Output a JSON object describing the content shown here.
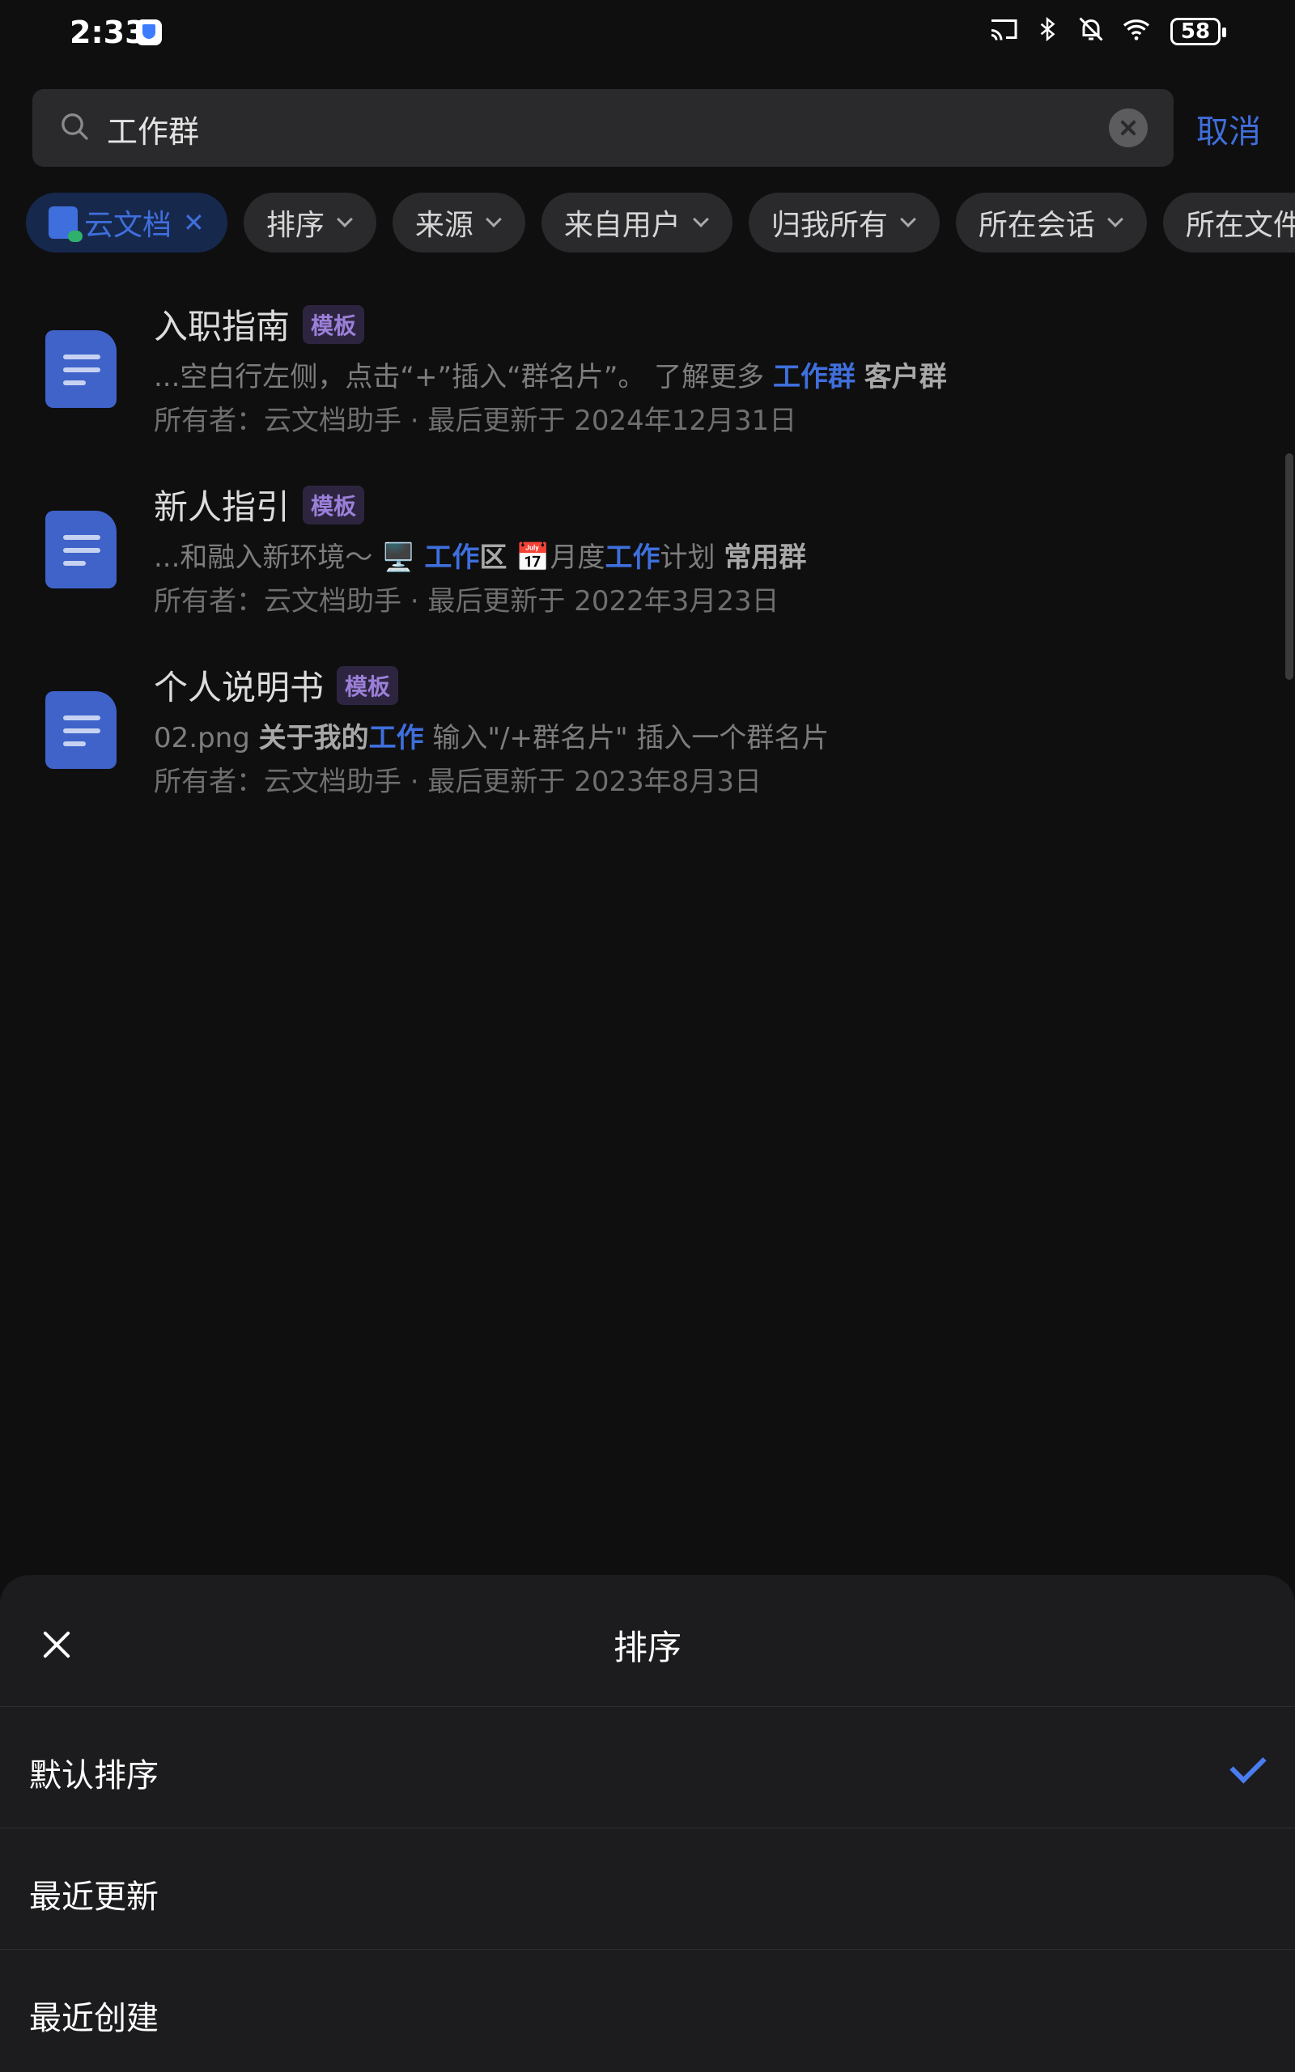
{
  "status": {
    "time": "2:33",
    "battery": "58"
  },
  "search": {
    "query": "工作群",
    "cancel": "取消"
  },
  "filters": [
    {
      "label": "云文档",
      "active": true
    },
    {
      "label": "排序"
    },
    {
      "label": "来源"
    },
    {
      "label": "来自用户"
    },
    {
      "label": "归我所有"
    },
    {
      "label": "所在会话"
    },
    {
      "label": "所在文件夹"
    }
  ],
  "results": [
    {
      "title": "入职指南",
      "badge": "模板",
      "snippet": [
        {
          "t": "...空白行左侧，点击“+”插入“群名片”。  了解更多  ",
          "s": "n"
        },
        {
          "t": "工作群",
          "s": "hl"
        },
        {
          "t": "  ",
          "s": "n"
        },
        {
          "t": "客户群",
          "s": "b"
        }
      ],
      "meta": "所有者：云文档助手 · 最后更新于 2024年12月31日"
    },
    {
      "title": "新人指引",
      "badge": "模板",
      "snippet": [
        {
          "t": "...和融入新环境～  🖥️  ",
          "s": "n"
        },
        {
          "t": "工作",
          "s": "hl"
        },
        {
          "t": "区",
          "s": "b"
        },
        {
          "t": "   📅月度",
          "s": "n"
        },
        {
          "t": "工作",
          "s": "hl"
        },
        {
          "t": "计划   ",
          "s": "n"
        },
        {
          "t": "常用群",
          "s": "b"
        }
      ],
      "meta": "所有者：云文档助手 · 最后更新于 2022年3月23日"
    },
    {
      "title": "个人说明书",
      "badge": "模板",
      "snippet": [
        {
          "t": "02.png  ",
          "s": "n"
        },
        {
          "t": "关于我的",
          "s": "b"
        },
        {
          "t": "工作",
          "s": "hl"
        },
        {
          "t": "  输入\"/+群名片\" 插入一个群名片",
          "s": "n"
        }
      ],
      "meta": "所有者：云文档助手 · 最后更新于 2023年8月3日"
    }
  ],
  "sheet": {
    "title": "排序",
    "options": [
      {
        "label": "默认排序",
        "selected": true
      },
      {
        "label": "最近更新",
        "selected": false
      },
      {
        "label": "最近创建",
        "selected": false
      }
    ]
  },
  "colors": {
    "accent": "#3f6fdc",
    "badge": "#9b7fd8",
    "background": "#0f0f10",
    "sheet": "#1c1c1e"
  }
}
